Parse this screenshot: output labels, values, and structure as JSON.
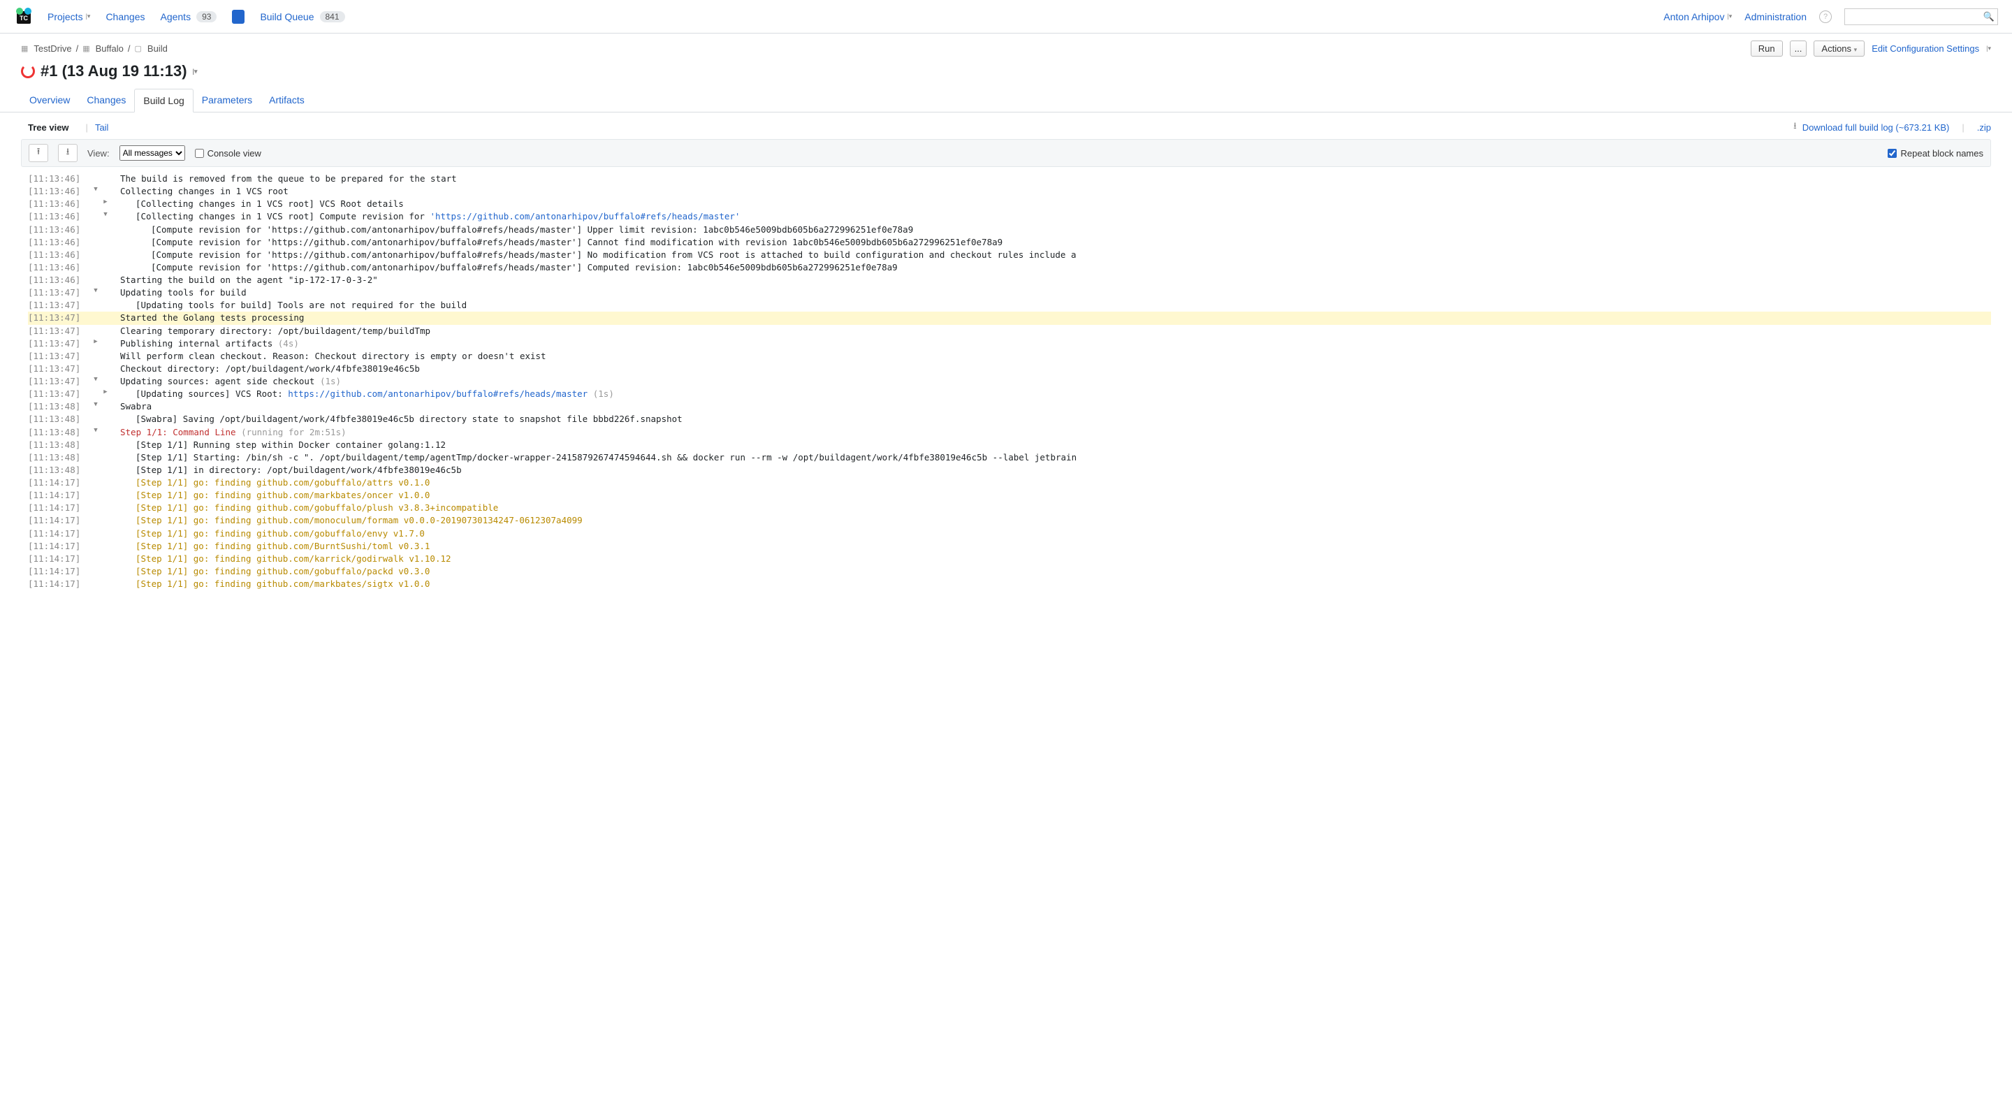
{
  "header": {
    "nav": {
      "projects": "Projects",
      "changes": "Changes",
      "agents": "Agents",
      "agents_badge": "93",
      "build_queue": "Build Queue",
      "bq_badge": "841"
    },
    "user": "Anton Arhipov",
    "admin": "Administration",
    "search_placeholder": ""
  },
  "breadcrumb": {
    "a": "TestDrive",
    "b": "Buffalo",
    "c": "Build"
  },
  "actions": {
    "run": "Run",
    "more": "...",
    "actions": "Actions",
    "edit": "Edit Configuration Settings"
  },
  "title": "#1 (13 Aug 19 11:13)",
  "tabs": [
    "Overview",
    "Changes",
    "Build Log",
    "Parameters",
    "Artifacts"
  ],
  "active_tab": "Build Log",
  "viewmode": {
    "tree": "Tree view",
    "tail": "Tail"
  },
  "download": {
    "label": "Download full build log (~673.21 KB)",
    "zip": ".zip"
  },
  "toolbar": {
    "view": "View:",
    "select": "All messages",
    "console": "Console view",
    "repeat": "Repeat block names"
  },
  "log": [
    {
      "ts": "[11:13:46]",
      "i": 0,
      "t": null,
      "msg": "The build is removed from the queue to be prepared for the start"
    },
    {
      "ts": "[11:13:46]",
      "i": 0,
      "t": "d",
      "msg": "Collecting changes in 1 VCS root"
    },
    {
      "ts": "[11:13:46]",
      "i": 1,
      "t": "r",
      "msg": "[Collecting changes in 1 VCS root] VCS Root details"
    },
    {
      "ts": "[11:13:46]",
      "i": 1,
      "t": "d",
      "pre": "[Collecting changes in 1 VCS root] Compute revision for ",
      "link": "'https://github.com/antonarhipov/buffalo#refs/heads/master'"
    },
    {
      "ts": "[11:13:46]",
      "i": 2,
      "t": null,
      "msg": "[Compute revision for 'https://github.com/antonarhipov/buffalo#refs/heads/master'] Upper limit revision: 1abc0b546e5009bdb605b6a272996251ef0e78a9"
    },
    {
      "ts": "[11:13:46]",
      "i": 2,
      "t": null,
      "msg": "[Compute revision for 'https://github.com/antonarhipov/buffalo#refs/heads/master'] Cannot find modification with revision 1abc0b546e5009bdb605b6a272996251ef0e78a9"
    },
    {
      "ts": "[11:13:46]",
      "i": 2,
      "t": null,
      "msg": "[Compute revision for 'https://github.com/antonarhipov/buffalo#refs/heads/master'] No modification from VCS root is attached to build configuration and checkout rules include a"
    },
    {
      "ts": "[11:13:46]",
      "i": 2,
      "t": null,
      "msg": "[Compute revision for 'https://github.com/antonarhipov/buffalo#refs/heads/master'] Computed revision: 1abc0b546e5009bdb605b6a272996251ef0e78a9"
    },
    {
      "ts": "[11:13:46]",
      "i": 0,
      "t": null,
      "msg": "Starting the build on the agent \"ip-172-17-0-3-2\""
    },
    {
      "ts": "[11:13:47]",
      "i": 0,
      "t": "d",
      "msg": "Updating tools for build"
    },
    {
      "ts": "[11:13:47]",
      "i": 1,
      "t": null,
      "msg": "[Updating tools for build] Tools are not required for the build"
    },
    {
      "ts": "[11:13:47]",
      "i": 0,
      "t": null,
      "hl": true,
      "msg": "Started the Golang tests processing"
    },
    {
      "ts": "[11:13:47]",
      "i": 0,
      "t": null,
      "msg": "Clearing temporary directory: /opt/buildagent/temp/buildTmp"
    },
    {
      "ts": "[11:13:47]",
      "i": 0,
      "t": "r",
      "msg": "Publishing internal artifacts",
      "dur": "(4s)"
    },
    {
      "ts": "[11:13:47]",
      "i": 0,
      "t": null,
      "msg": "Will perform clean checkout. Reason: Checkout directory is empty or doesn't exist"
    },
    {
      "ts": "[11:13:47]",
      "i": 0,
      "t": null,
      "msg": "Checkout directory: /opt/buildagent/work/4fbfe38019e46c5b"
    },
    {
      "ts": "[11:13:47]",
      "i": 0,
      "t": "d",
      "msg": "Updating sources: agent side checkout",
      "dur": "(1s)"
    },
    {
      "ts": "[11:13:47]",
      "i": 1,
      "t": "r",
      "pre": "[Updating sources] VCS Root: ",
      "link": "https://github.com/antonarhipov/buffalo#refs/heads/master",
      "dur": "(1s)"
    },
    {
      "ts": "[11:13:48]",
      "i": 0,
      "t": "d",
      "msg": "Swabra"
    },
    {
      "ts": "[11:13:48]",
      "i": 1,
      "t": null,
      "msg": "[Swabra] Saving /opt/buildagent/work/4fbfe38019e46c5b directory state to snapshot file bbbd226f.snapshot"
    },
    {
      "ts": "[11:13:48]",
      "i": 0,
      "t": "d",
      "red": "Step 1/1: Command Line",
      "dur": "(running for 2m:51s)"
    },
    {
      "ts": "[11:13:48]",
      "i": 1,
      "t": null,
      "msg": "[Step 1/1] Running step within Docker container golang:1.12"
    },
    {
      "ts": "[11:13:48]",
      "i": 1,
      "t": null,
      "msg": "[Step 1/1] Starting: /bin/sh -c \". /opt/buildagent/temp/agentTmp/docker-wrapper-2415879267474594644.sh && docker run --rm -w /opt/buildagent/work/4fbfe38019e46c5b --label jetbrain"
    },
    {
      "ts": "[11:13:48]",
      "i": 1,
      "t": null,
      "msg": "[Step 1/1] in directory: /opt/buildagent/work/4fbfe38019e46c5b"
    },
    {
      "ts": "[11:14:17]",
      "i": 1,
      "t": null,
      "gold": "[Step 1/1] go: finding github.com/gobuffalo/attrs v0.1.0"
    },
    {
      "ts": "[11:14:17]",
      "i": 1,
      "t": null,
      "gold": "[Step 1/1] go: finding github.com/markbates/oncer v1.0.0"
    },
    {
      "ts": "[11:14:17]",
      "i": 1,
      "t": null,
      "gold": "[Step 1/1] go: finding github.com/gobuffalo/plush v3.8.3+incompatible"
    },
    {
      "ts": "[11:14:17]",
      "i": 1,
      "t": null,
      "gold": "[Step 1/1] go: finding github.com/monoculum/formam v0.0.0-20190730134247-0612307a4099"
    },
    {
      "ts": "[11:14:17]",
      "i": 1,
      "t": null,
      "gold": "[Step 1/1] go: finding github.com/gobuffalo/envy v1.7.0"
    },
    {
      "ts": "[11:14:17]",
      "i": 1,
      "t": null,
      "gold": "[Step 1/1] go: finding github.com/BurntSushi/toml v0.3.1"
    },
    {
      "ts": "[11:14:17]",
      "i": 1,
      "t": null,
      "gold": "[Step 1/1] go: finding github.com/karrick/godirwalk v1.10.12"
    },
    {
      "ts": "[11:14:17]",
      "i": 1,
      "t": null,
      "gold": "[Step 1/1] go: finding github.com/gobuffalo/packd v0.3.0"
    },
    {
      "ts": "[11:14:17]",
      "i": 1,
      "t": null,
      "gold": "[Step 1/1] go: finding github.com/markbates/sigtx v1.0.0"
    }
  ]
}
